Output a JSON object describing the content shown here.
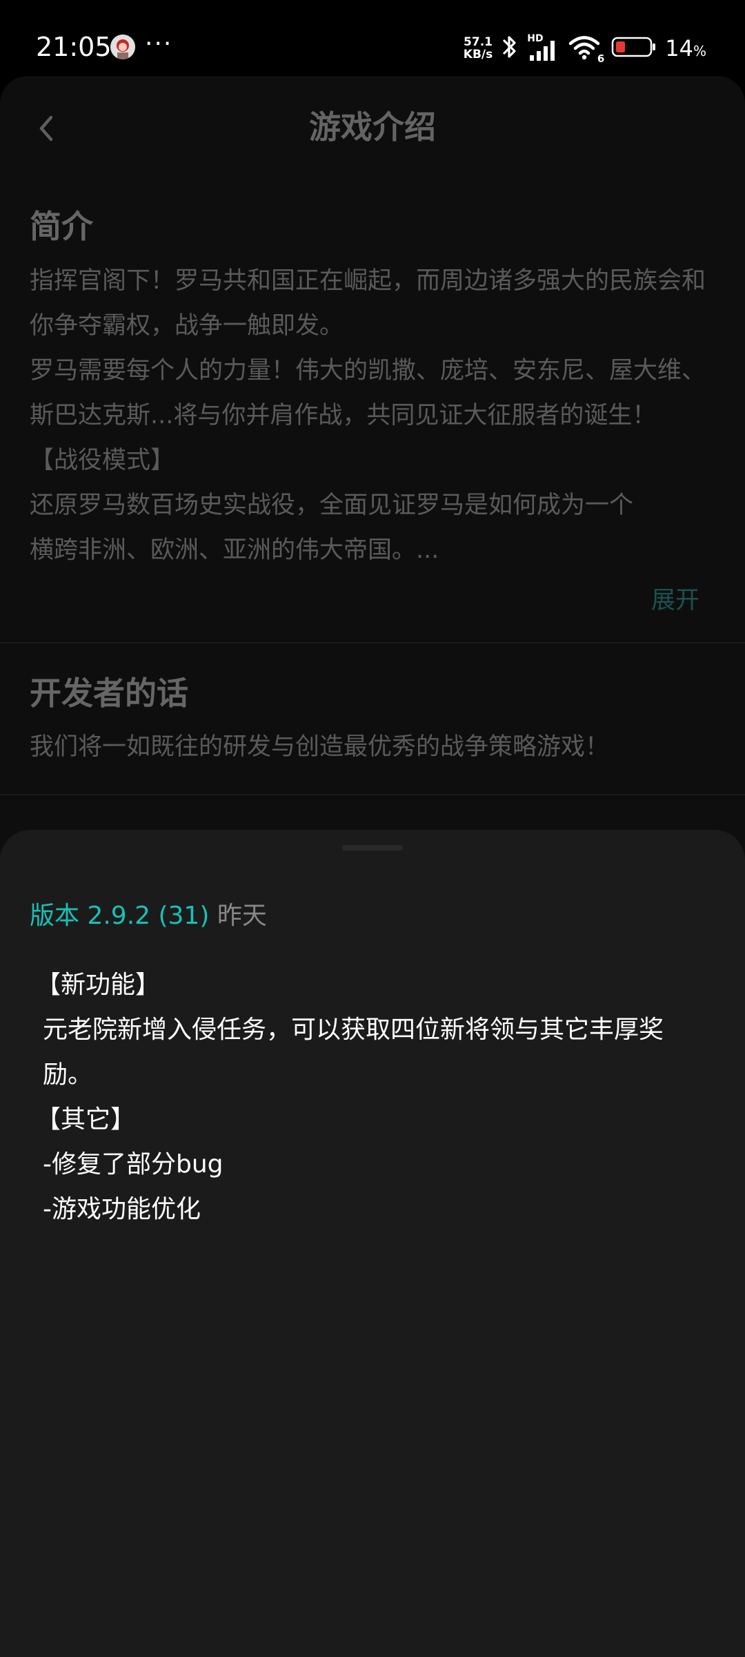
{
  "status_bar": {
    "time": "21:05",
    "more": "···",
    "speed_value": "57.1",
    "speed_unit": "KB/s",
    "hd": "HD",
    "wifi_badge": "6",
    "battery_percent": "14",
    "battery_unit": "%",
    "battery_level": 0.14,
    "battery_color": "#e53935"
  },
  "header": {
    "title": "游戏介绍",
    "back_icon": "chevron-left-icon"
  },
  "intro": {
    "heading": "简介",
    "lines": [
      "指挥官阁下！罗马共和国正在崛起，而周边诸多强大的民族会和你争夺霸权，战争一触即发。",
      "罗马需要每个人的力量！伟大的凯撒、庞培、安东尼、屋大维、斯巴达克斯...将与你并肩作战，共同见证大征服者的诞生！",
      "【战役模式】",
      "还原罗马数百场史实战役，全面见证罗马是如何成为一个横跨非洲、欧洲、亚洲的伟大帝国。..."
    ],
    "expand_label": "展开"
  },
  "developer": {
    "heading": "开发者的话",
    "text": "我们将一如既往的研发与创造最优秀的战争策略游戏！"
  },
  "version_sheet": {
    "version_label": "版本 2.9.2 (31)",
    "date": "昨天",
    "changelog": [
      "【新功能】",
      "元老院新增入侵任务，可以获取四位新将领与其它丰厚奖励。",
      "【其它】",
      "-修复了部分bug",
      "-游戏功能优化"
    ]
  },
  "colors": {
    "accent": "#17c2b6",
    "expand_link_dimmed": "#1d5150",
    "sheet_background": "#1b1b1b",
    "page_background_dimmed": "#0e0e0e"
  }
}
